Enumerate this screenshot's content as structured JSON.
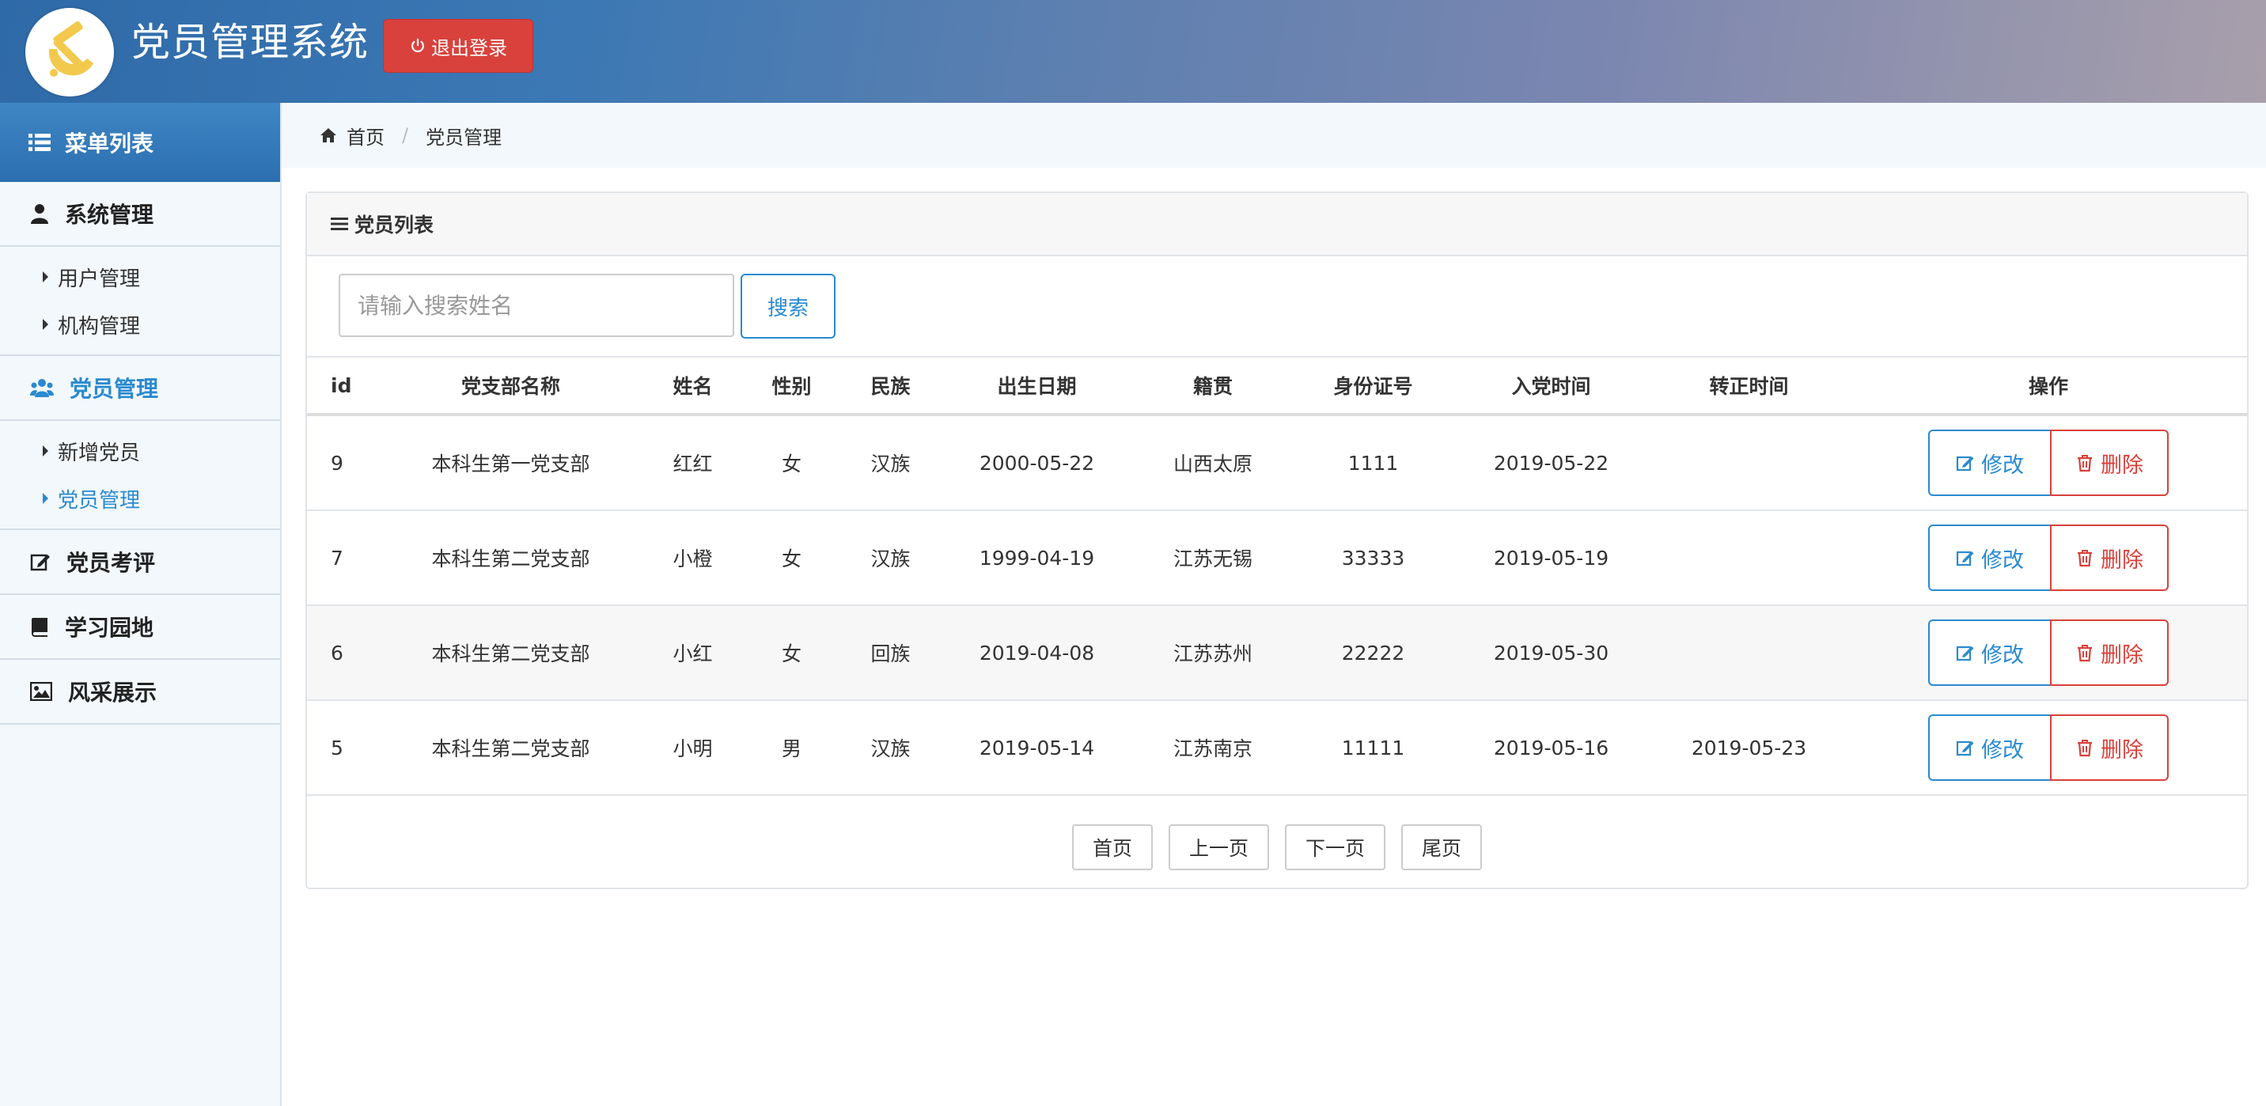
{
  "header": {
    "app_title": "党员管理系统",
    "logout_label": "退出登录"
  },
  "sidebar": {
    "menu_title": "菜单列表",
    "groups": [
      {
        "label": "系统管理",
        "icon": "user-icon",
        "items": [
          "用户管理",
          "机构管理"
        ]
      },
      {
        "label": "党员管理",
        "icon": "users-icon",
        "items": [
          "新增党员",
          "党员管理"
        ],
        "active_item": "党员管理"
      },
      {
        "label": "党员考评",
        "icon": "edit-icon"
      },
      {
        "label": "学习园地",
        "icon": "book-icon"
      },
      {
        "label": "风采展示",
        "icon": "image-icon"
      }
    ]
  },
  "breadcrumb": {
    "home": "首页",
    "current": "党员管理"
  },
  "panel": {
    "title": "党员列表",
    "search_placeholder": "请输入搜索姓名",
    "search_label": "搜索",
    "columns": [
      "id",
      "党支部名称",
      "姓名",
      "性别",
      "民族",
      "出生日期",
      "籍贯",
      "身份证号",
      "入党时间",
      "转正时间",
      "操作"
    ],
    "rows": [
      [
        "9",
        "本科生第一党支部",
        "红红",
        "女",
        "汉族",
        "2000-05-22",
        "山西太原",
        "1111",
        "2019-05-22",
        ""
      ],
      [
        "7",
        "本科生第二党支部",
        "小橙",
        "女",
        "汉族",
        "1999-04-19",
        "江苏无锡",
        "33333",
        "2019-05-19",
        ""
      ],
      [
        "6",
        "本科生第二党支部",
        "小红",
        "女",
        "回族",
        "2019-04-08",
        "江苏苏州",
        "22222",
        "2019-05-30",
        ""
      ],
      [
        "5",
        "本科生第二党支部",
        "小明",
        "男",
        "汉族",
        "2019-05-14",
        "江苏南京",
        "11111",
        "2019-05-16",
        "2019-05-23"
      ]
    ],
    "edit_label": "修改",
    "delete_label": "删除",
    "pager": {
      "first": "首页",
      "prev": "上一页",
      "next": "下一页",
      "last": "尾页"
    }
  },
  "colors": {
    "accent": "#2a8ad0",
    "danger": "#d9413c",
    "party_yellow": "#f2c94c"
  }
}
